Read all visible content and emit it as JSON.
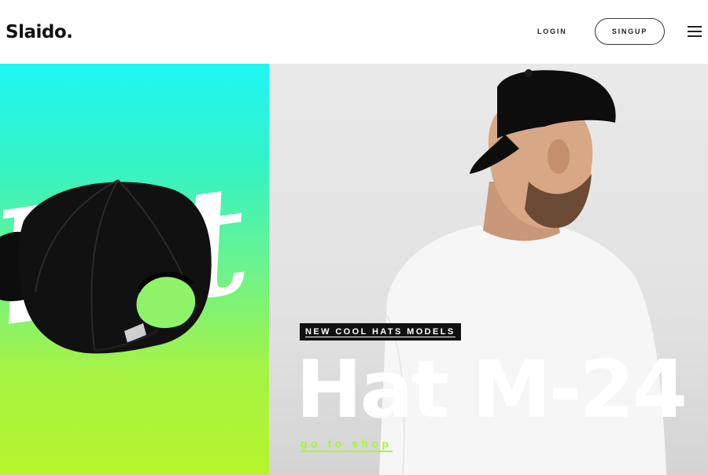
{
  "header": {
    "logo": "Slaido.",
    "login_label": "LOGIN",
    "signup_label": "SINGUP",
    "menu_icon": "hamburger-menu-icon"
  },
  "hero": {
    "left_panel": {
      "gradient_colors": [
        "#1ff5f3",
        "#6cf38c",
        "#b5f52c"
      ],
      "image": "black-baseball-cap"
    },
    "right_panel": {
      "image": "man-in-white-tshirt-wearing-backwards-black-cap"
    },
    "tag": "NEW COOL HATS MODELS",
    "headline": "Hat M-24",
    "cta": "go to shop",
    "accent_color": "#a8f53a"
  }
}
